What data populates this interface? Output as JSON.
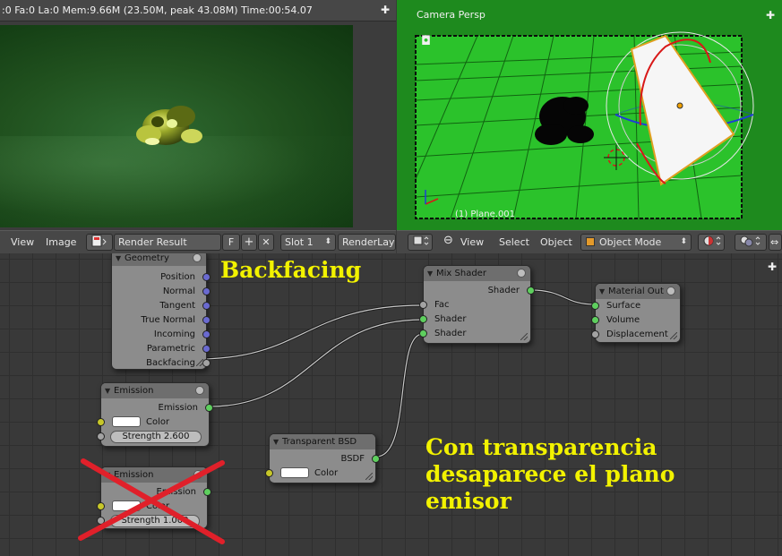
{
  "render": {
    "stats": ":0 Fa:0 La:0 Mem:9.66M (23.50M, peak 43.08M) Time:00:54.07",
    "toolbar": {
      "view": "View",
      "image": "Image",
      "image_name": "Render Result",
      "fake_user": "F",
      "slot": "Slot 1",
      "render_layer": "RenderLayer"
    }
  },
  "viewport": {
    "title": "Camera Persp",
    "object_label": "(1) Plane.001",
    "toolbar": {
      "view": "View",
      "select": "Select",
      "object": "Object",
      "mode": "Object Mode"
    }
  },
  "nodes": {
    "geometry": {
      "title": "Geometry",
      "outputs": [
        "Position",
        "Normal",
        "Tangent",
        "True Normal",
        "Incoming",
        "Parametric",
        "Backfacing"
      ]
    },
    "emission1": {
      "title": "Emission",
      "output": "Emission",
      "color_label": "Color",
      "strength": "Strength 2.600"
    },
    "emission2": {
      "title": "Emission",
      "output": "Emission",
      "color_label": "Color",
      "strength": "Strength 1.000"
    },
    "transparent": {
      "title": "Transparent BSD",
      "output": "BSDF",
      "color_label": "Color"
    },
    "mix": {
      "title": "Mix Shader",
      "output": "Shader",
      "inputs": [
        "Fac",
        "Shader",
        "Shader"
      ]
    },
    "material_out": {
      "title": "Material Out",
      "inputs": [
        "Surface",
        "Volume",
        "Displacement"
      ]
    }
  },
  "annotations": {
    "backfacing": "Backfacing",
    "note_line1": "Con transparencia",
    "note_line2": "desaparece el plano",
    "note_line3": "emisor"
  },
  "colors": {
    "annotation": "#f2f200",
    "viewport_bg": "#1f8a1f",
    "camera_frame": "#2bc22b",
    "cross_out": "#e0202a",
    "socket_shader": "#5ecf5e",
    "socket_vector": "#6a6ad0",
    "socket_color": "#c7c729",
    "socket_float": "#a3a3a3"
  }
}
